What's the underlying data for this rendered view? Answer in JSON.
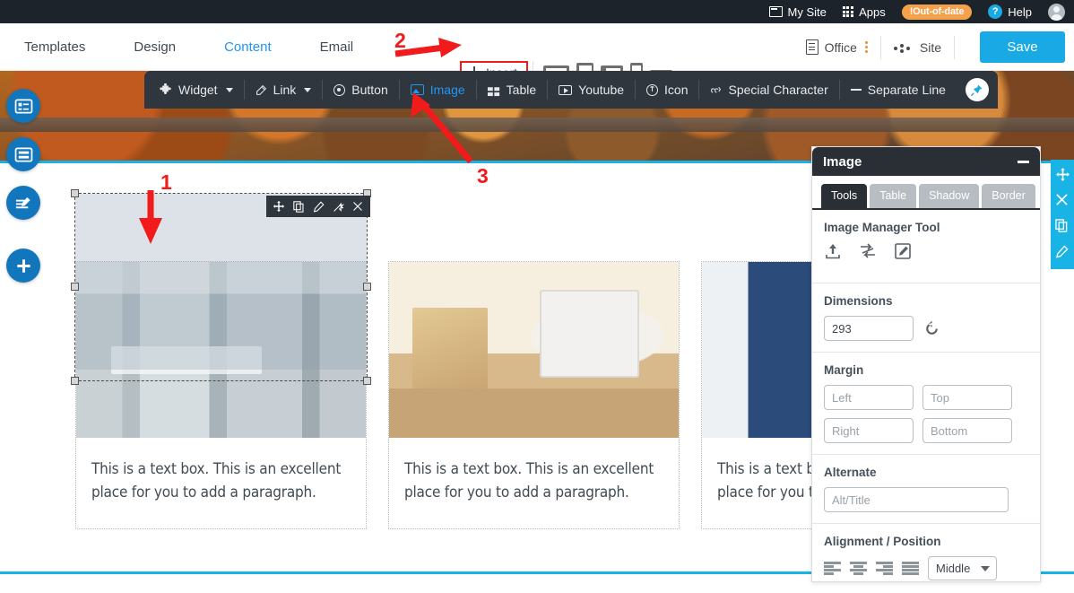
{
  "topbar": {
    "items": [
      {
        "label": "My Site",
        "icon": "window-icon"
      },
      {
        "label": "Apps",
        "icon": "apps-grid-icon"
      }
    ],
    "badge": "!Out-of-date",
    "help_label": "Help",
    "help_glyph": "?",
    "avatar": "user-avatar",
    "bg_color": "#1d232b",
    "badge_color": "#f5a04a"
  },
  "nav": {
    "tabs": [
      {
        "label": "Templates",
        "active": false
      },
      {
        "label": "Design",
        "active": false
      },
      {
        "label": "Content",
        "active": true
      },
      {
        "label": "Email",
        "active": false
      }
    ],
    "active_color": "#2196f3"
  },
  "toolbar": {
    "insert_label": "Insert",
    "insert_icon": "download-icon",
    "insert_highlight_color": "#f11b1b",
    "devices": [
      {
        "name": "desktop-preview-icon"
      },
      {
        "name": "tablet-portrait-preview-icon"
      },
      {
        "name": "tablet-landscape-preview-icon"
      },
      {
        "name": "mobile-portrait-preview-icon"
      },
      {
        "name": "mobile-landscape-preview-icon"
      }
    ],
    "office_label": "Office",
    "office_icon": "document-icon",
    "kebab_icon": "vertical-dots-icon",
    "site_label": "Site",
    "site_icon": "dots-cluster-icon",
    "save_label": "Save",
    "save_color": "#19a9e5"
  },
  "insert_toolbar": {
    "items": [
      {
        "label": "Widget",
        "icon": "puzzle-icon",
        "caret": true,
        "active": false
      },
      {
        "label": "Link",
        "icon": "link-icon",
        "caret": true,
        "active": false
      },
      {
        "label": "Button",
        "icon": "radio-icon",
        "caret": false,
        "active": false
      },
      {
        "label": "Image",
        "icon": "image-icon",
        "caret": false,
        "active": true
      },
      {
        "label": "Table",
        "icon": "table-icon",
        "caret": false,
        "active": false
      },
      {
        "label": "Youtube",
        "icon": "youtube-icon",
        "caret": false,
        "active": false
      },
      {
        "label": "Icon",
        "icon": "info-circle-icon",
        "caret": false,
        "active": false
      },
      {
        "label": "Special Character",
        "icon": "special-char-icon",
        "caret": false,
        "active": false
      },
      {
        "label": "Separate Line",
        "icon": "dash-icon",
        "caret": false,
        "active": false
      }
    ],
    "pin_icon": "pin-icon",
    "bg_color": "#30363d",
    "active_color": "#2196f3"
  },
  "left_buttons": [
    {
      "name": "add-section-layout-button",
      "icon": "layout-list-icon"
    },
    {
      "name": "add-block-button",
      "icon": "layout-rows-icon"
    },
    {
      "name": "edit-text-button",
      "icon": "edit-lines-icon"
    },
    {
      "name": "add-element-button",
      "icon": "plus-icon"
    }
  ],
  "edge_tools": [
    {
      "name": "move-handle",
      "icon": "move-arrows-icon"
    },
    {
      "name": "delete-button",
      "icon": "close-icon"
    },
    {
      "name": "duplicate-button",
      "icon": "copy-icon"
    },
    {
      "name": "edit-button",
      "icon": "pencil-icon"
    }
  ],
  "image_toolbar": [
    {
      "name": "move-image-button",
      "icon": "move-arrows-icon"
    },
    {
      "name": "duplicate-image-button",
      "icon": "copy-icon"
    },
    {
      "name": "edit-image-button",
      "icon": "pencil-icon"
    },
    {
      "name": "effects-image-button",
      "icon": "magic-wand-icon"
    },
    {
      "name": "remove-image-button",
      "icon": "close-icon"
    }
  ],
  "canvas": {
    "banner_accent_color": "#19b3e6",
    "cards": [
      {
        "image": "office-meeting-room",
        "text": "This is a text box. This is an excellent place for you to add a paragraph.",
        "selected": true
      },
      {
        "image": "desk-with-monitor",
        "text": "This is a text box. This is an excellent place for you to add a paragraph.",
        "selected": false
      },
      {
        "image": "white-hallway-coat-stand",
        "text": "This is a text box. This is an excellent place for you to add a paragraph.",
        "selected": false
      }
    ]
  },
  "panel": {
    "title": "Image",
    "minimize_icon": "minimize-icon",
    "tabs": [
      {
        "label": "Tools",
        "active": true
      },
      {
        "label": "Table",
        "active": false
      },
      {
        "label": "Shadow",
        "active": false
      },
      {
        "label": "Border",
        "active": false
      }
    ],
    "manager": {
      "label": "Image Manager Tool",
      "tools": [
        {
          "name": "upload-image-icon"
        },
        {
          "name": "replace-image-icon"
        },
        {
          "name": "edit-image-icon"
        }
      ]
    },
    "dimensions": {
      "label": "Dimensions",
      "value": "293",
      "reset_icon": "reset-icon"
    },
    "margin": {
      "label": "Margin",
      "left_placeholder": "Left",
      "top_placeholder": "Top",
      "right_placeholder": "Right",
      "bottom_placeholder": "Bottom"
    },
    "alternate": {
      "label": "Alternate",
      "placeholder": "Alt/Title"
    },
    "alignment": {
      "label": "Alignment / Position",
      "icons": [
        {
          "name": "align-left-icon"
        },
        {
          "name": "align-center-icon"
        },
        {
          "name": "align-right-icon"
        },
        {
          "name": "align-justify-icon"
        }
      ],
      "position_value": "Middle"
    }
  },
  "annotations": [
    {
      "label": "1",
      "target": "selected-image"
    },
    {
      "label": "2",
      "target": "insert-button"
    },
    {
      "label": "3",
      "target": "image-menu-item"
    }
  ]
}
